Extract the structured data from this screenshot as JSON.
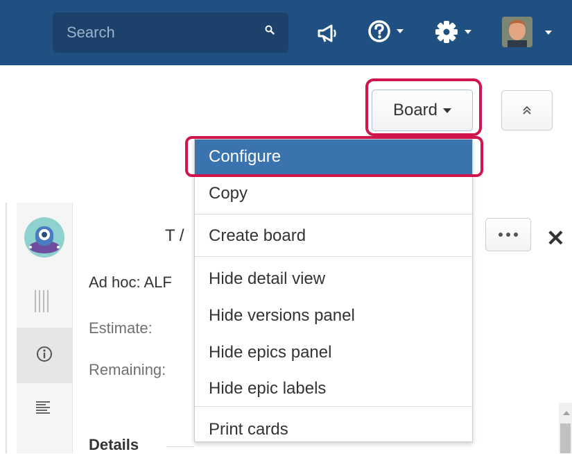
{
  "topbar": {
    "search_placeholder": "Search",
    "icons": [
      "search-icon",
      "megaphone-icon",
      "help-icon",
      "gear-icon",
      "avatar"
    ]
  },
  "header": {
    "board_button_label": "Board",
    "collapse_icon": "double-chevron-up-icon"
  },
  "board_menu": {
    "items": [
      {
        "label": "Configure",
        "active": true
      },
      {
        "label": "Copy"
      },
      {
        "label": "Create board"
      },
      {
        "label": "Hide detail view"
      },
      {
        "label": "Hide versions panel"
      },
      {
        "label": "Hide epics panel"
      },
      {
        "label": "Hide epic labels"
      },
      {
        "label": "Print cards"
      }
    ]
  },
  "detail_panel": {
    "issue_key_partial": "T /",
    "sprint_partial": "Ad hoc: ALF",
    "estimate_label": "Estimate:",
    "remaining_label": "Remaining:",
    "details_heading": "Details"
  },
  "colors": {
    "nav_bg": "#205081",
    "menu_active": "#3b73af",
    "highlight": "#d1144c"
  }
}
